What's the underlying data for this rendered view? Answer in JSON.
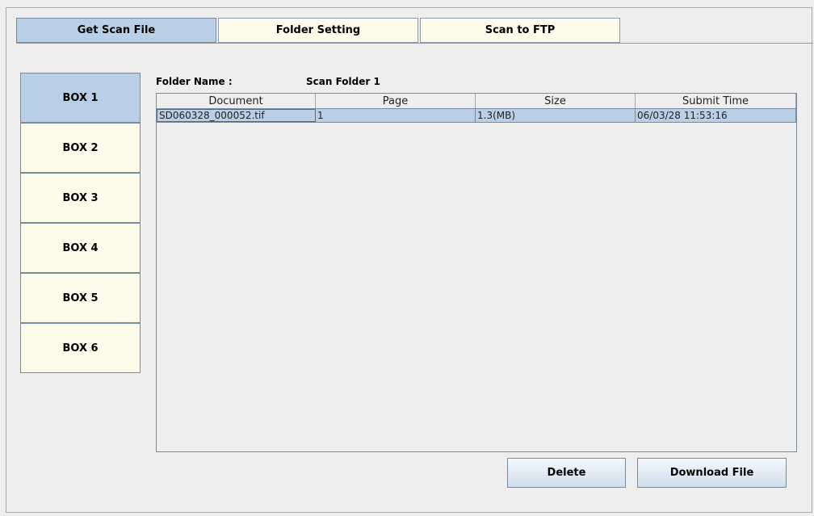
{
  "tabs": [
    {
      "label": "Get Scan File",
      "selected": true
    },
    {
      "label": "Folder Setting",
      "selected": false
    },
    {
      "label": "Scan to FTP",
      "selected": false
    }
  ],
  "boxes": [
    {
      "label": "BOX 1",
      "selected": true
    },
    {
      "label": "BOX 2",
      "selected": false
    },
    {
      "label": "BOX 3",
      "selected": false
    },
    {
      "label": "BOX 4",
      "selected": false
    },
    {
      "label": "BOX 5",
      "selected": false
    },
    {
      "label": "BOX 6",
      "selected": false
    }
  ],
  "folder": {
    "name_label": "Folder Name :",
    "name_value": "Scan Folder 1"
  },
  "table": {
    "columns": [
      "Document",
      "Page",
      "Size",
      "Submit Time"
    ],
    "rows": [
      {
        "document": "SD060328_000052.tif",
        "page": "1",
        "size": "1.3(MB)",
        "submit_time": "06/03/28 11:53:16",
        "selected": true
      }
    ]
  },
  "actions": {
    "delete_label": "Delete",
    "download_label": "Download File"
  },
  "colors": {
    "selected": "#b8cfe5",
    "unselected": "#fdfbe9",
    "background": "#eeeeee",
    "border": "#7a8a99"
  }
}
